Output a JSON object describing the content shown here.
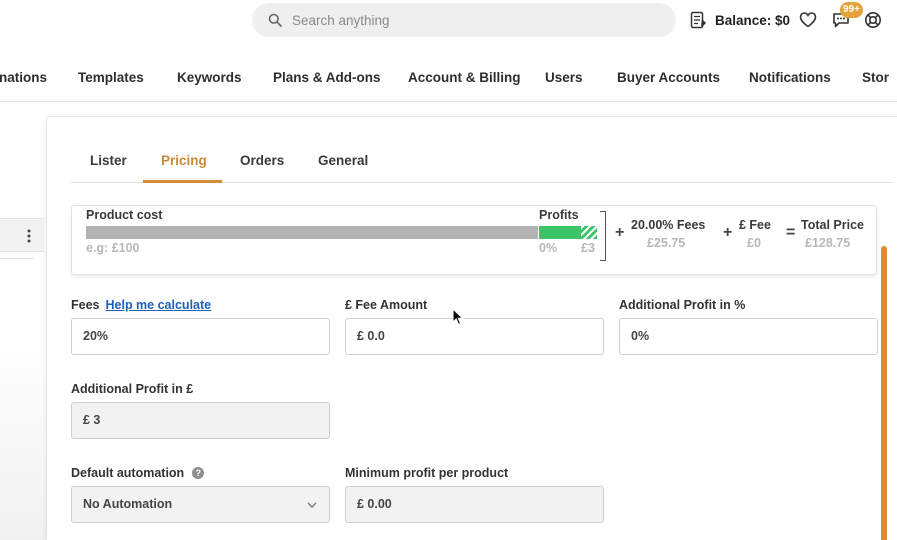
{
  "header": {
    "search_placeholder": "Search anything",
    "balance": "Balance: $0",
    "notifications_badge": "99+"
  },
  "nav": {
    "items": [
      "nations",
      "Templates",
      "Keywords",
      "Plans & Add-ons",
      "Account & Billing",
      "Users",
      "Buyer Accounts",
      "Notifications",
      "Stor"
    ]
  },
  "tabs": [
    "Lister",
    "Pricing",
    "Orders",
    "General"
  ],
  "active_tab": "Pricing",
  "formula": {
    "product_cost_label": "Product cost",
    "product_cost_example": "e.g: £100",
    "profits_label": "Profits",
    "profits_percent": "0%",
    "profits_amount": "£3",
    "plus1": "+",
    "fees_label": "20.00% Fees",
    "fees_amount": "£25.75",
    "plus2": "+",
    "fee_label": "£ Fee",
    "fee_amount": "£0",
    "equals": "=",
    "total_label": "Total Price",
    "total_amount": "£128.75"
  },
  "form": {
    "fees_label": "Fees",
    "help_link": "Help me calculate",
    "fees_value": "20%",
    "fee_amount_label": "£ Fee Amount",
    "fee_amount_value": "£ 0.0",
    "additional_profit_pct_label": "Additional Profit in %",
    "additional_profit_pct_value": "0%",
    "additional_profit_gbp_label": "Additional Profit in £",
    "additional_profit_gbp_value": "£ 3",
    "default_automation_label": "Default automation",
    "help_icon_glyph": "?",
    "default_automation_value": "No Automation",
    "min_profit_label": "Minimum profit per product",
    "min_profit_value": "£ 0.00"
  },
  "colors": {
    "accent": "#d48b3a",
    "profit_green": "#3cc46a",
    "link": "#1f5fb8",
    "badge": "#e3a33a"
  }
}
